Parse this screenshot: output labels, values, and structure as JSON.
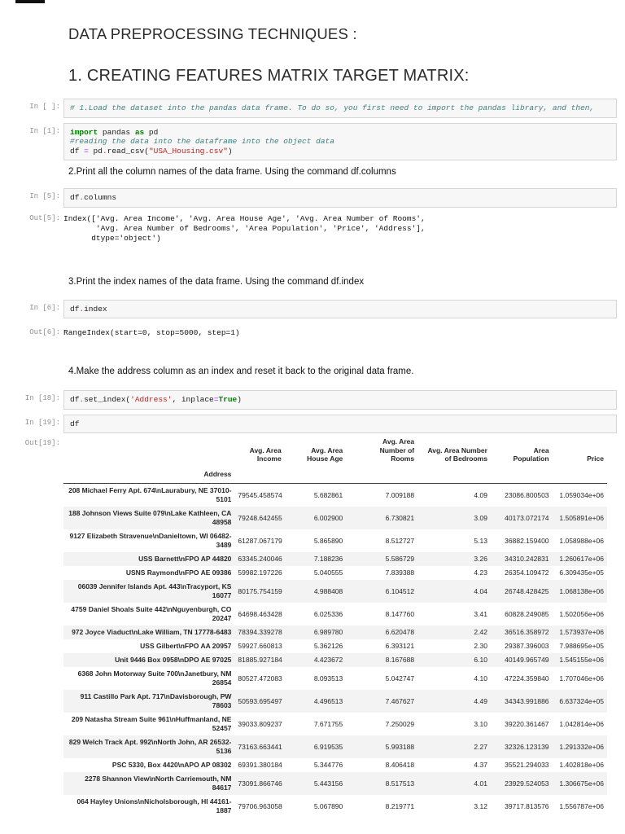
{
  "page": {
    "title": "DATA PREPROCESSING TECHNIQUES :",
    "section_heading": "1. CREATING FEATURES MATRIX TARGET MATRIX:"
  },
  "syntax_colors": {
    "comment": "#408080",
    "keyword": "#008000",
    "operator": "#AA22FF",
    "string": "#BA2121",
    "prompt": "#8f8f8f",
    "cell_background": "#f7f7f7",
    "row_stripe": "#f3f3f3"
  },
  "paragraphs": {
    "p2": "2.Print all the column names of the data frame. Using the command df.columns",
    "p3": "3.Print the index names of the data frame. Using the command df.index",
    "p4": "4.Make the address column as an index and reset it back to the original data frame."
  },
  "cells": {
    "c0": {
      "prompt": "In [ ]:",
      "code": [
        [
          [
            "cm",
            "# 1.Load the dataset into the pandas data frame. To do so, you first need to import the pandas library, and then,"
          ]
        ]
      ]
    },
    "c1": {
      "prompt": "In [1]:",
      "code": [
        [
          [
            "kw",
            "import"
          ],
          [
            "pl",
            " pandas "
          ],
          [
            "kw",
            "as"
          ],
          [
            "pl",
            " pd"
          ]
        ],
        [
          [
            "cm",
            "#reading the data into the dataframe into the object data"
          ]
        ],
        [
          [
            "pl",
            "df "
          ],
          [
            "op",
            "="
          ],
          [
            "pl",
            " pd"
          ],
          [
            "op",
            "."
          ],
          [
            "pl",
            "read_csv("
          ],
          [
            "st",
            "\"USA_Housing.csv\""
          ],
          [
            "pl",
            ")"
          ]
        ]
      ]
    },
    "c5in": {
      "prompt": "In [5]:",
      "code": [
        [
          [
            "pl",
            "df"
          ],
          [
            "op",
            "."
          ],
          [
            "pl",
            "columns"
          ]
        ]
      ]
    },
    "c5out": {
      "prompt": "Out[5]:",
      "text": "Index(['Avg. Area Income', 'Avg. Area House Age', 'Avg. Area Number of Rooms',\n       'Avg. Area Number of Bedrooms', 'Area Population', 'Price', 'Address'],\n      dtype='object')"
    },
    "c6in": {
      "prompt": "In [6]:",
      "code": [
        [
          [
            "pl",
            "df"
          ],
          [
            "op",
            "."
          ],
          [
            "pl",
            "index"
          ]
        ]
      ]
    },
    "c6out": {
      "prompt": "Out[6]:",
      "text": "RangeIndex(start=0, stop=5000, step=1)"
    },
    "c18": {
      "prompt": "In [18]:",
      "code": [
        [
          [
            "pl",
            "df"
          ],
          [
            "op",
            "."
          ],
          [
            "pl",
            "set_index("
          ],
          [
            "st",
            "'Address'"
          ],
          [
            "pl",
            ", inplace"
          ],
          [
            "op",
            "="
          ],
          [
            "kw",
            "True"
          ],
          [
            "pl",
            ")"
          ]
        ]
      ]
    },
    "c19": {
      "prompt": "In [19]:",
      "code": [
        [
          [
            "pl",
            "df"
          ]
        ]
      ]
    }
  },
  "table": {
    "prompt": "Out[19]:",
    "index_label": "Address",
    "columns": [
      "Avg. Area\nIncome",
      "Avg. Area\nHouse Age",
      "Avg. Area\nNumber of\nRooms",
      "Avg. Area Number\nof Bedrooms",
      "Area\nPopulation",
      "Price"
    ],
    "rows": [
      {
        "address": "208 Michael Ferry Apt. 674\\nLaurabury, NE 37010-5101",
        "values": [
          "79545.458574",
          "5.682861",
          "7.009188",
          "4.09",
          "23086.800503",
          "1.059034e+06"
        ]
      },
      {
        "address": "188 Johnson Views Suite 079\\nLake Kathleen, CA 48958",
        "values": [
          "79248.642455",
          "6.002900",
          "6.730821",
          "3.09",
          "40173.072174",
          "1.505891e+06"
        ]
      },
      {
        "address": "9127 Elizabeth Stravenue\\nDanieltown, WI 06482-3489",
        "values": [
          "61287.067179",
          "5.865890",
          "8.512727",
          "5.13",
          "36882.159400",
          "1.058988e+06"
        ]
      },
      {
        "address": "USS Barnett\\nFPO AP 44820",
        "values": [
          "63345.240046",
          "7.188236",
          "5.586729",
          "3.26",
          "34310.242831",
          "1.260617e+06"
        ]
      },
      {
        "address": "USNS Raymond\\nFPO AE 09386",
        "values": [
          "59982.197226",
          "5.040555",
          "7.839388",
          "4.23",
          "26354.109472",
          "6.309435e+05"
        ]
      },
      {
        "address": "06039 Jennifer Islands Apt. 443\\nTracyport, KS 16077",
        "values": [
          "80175.754159",
          "4.988408",
          "6.104512",
          "4.04",
          "26748.428425",
          "1.068138e+06"
        ]
      },
      {
        "address": "4759 Daniel Shoals Suite 442\\nNguyenburgh, CO 20247",
        "values": [
          "64698.463428",
          "6.025336",
          "8.147760",
          "3.41",
          "60828.249085",
          "1.502056e+06"
        ]
      },
      {
        "address": "972 Joyce Viaduct\\nLake William, TN 17778-6483",
        "values": [
          "78394.339278",
          "6.989780",
          "6.620478",
          "2.42",
          "36516.358972",
          "1.573937e+06"
        ]
      },
      {
        "address": "USS Gilbert\\nFPO AA 20957",
        "values": [
          "59927.660813",
          "5.362126",
          "6.393121",
          "2.30",
          "29387.396003",
          "7.988695e+05"
        ]
      },
      {
        "address": "Unit 9446 Box 0958\\nDPO AE 97025",
        "values": [
          "81885.927184",
          "4.423672",
          "8.167688",
          "6.10",
          "40149.965749",
          "1.545155e+06"
        ]
      },
      {
        "address": "6368 John Motorway Suite 700\\nJanetbury, NM 26854",
        "values": [
          "80527.472083",
          "8.093513",
          "5.042747",
          "4.10",
          "47224.359840",
          "1.707046e+06"
        ]
      },
      {
        "address": "911 Castillo Park Apt. 717\\nDavisborough, PW 78603",
        "values": [
          "50593.695497",
          "4.496513",
          "7.467627",
          "4.49",
          "34343.991886",
          "6.637324e+05"
        ]
      },
      {
        "address": "209 Natasha Stream Suite 961\\nHuffmanland, NE 52457",
        "values": [
          "39033.809237",
          "7.671755",
          "7.250029",
          "3.10",
          "39220.361467",
          "1.042814e+06"
        ]
      },
      {
        "address": "829 Welch Track Apt. 992\\nNorth John, AR 26532-5136",
        "values": [
          "73163.663441",
          "6.919535",
          "5.993188",
          "2.27",
          "32326.123139",
          "1.291332e+06"
        ]
      },
      {
        "address": "PSC 5330, Box 4420\\nAPO AP 08302",
        "values": [
          "69391.380184",
          "5.344776",
          "8.406418",
          "4.37",
          "35521.294033",
          "1.402818e+06"
        ]
      },
      {
        "address": "2278 Shannon View\\nNorth Carriemouth, NM 84617",
        "values": [
          "73091.866746",
          "5.443156",
          "8.517513",
          "4.01",
          "23929.524053",
          "1.306675e+06"
        ]
      },
      {
        "address": "064 Hayley Unions\\nNicholsborough, HI 44161-1887",
        "values": [
          "79706.963058",
          "5.067890",
          "8.219771",
          "3.12",
          "39717.813576",
          "1.556787e+06"
        ]
      }
    ]
  }
}
